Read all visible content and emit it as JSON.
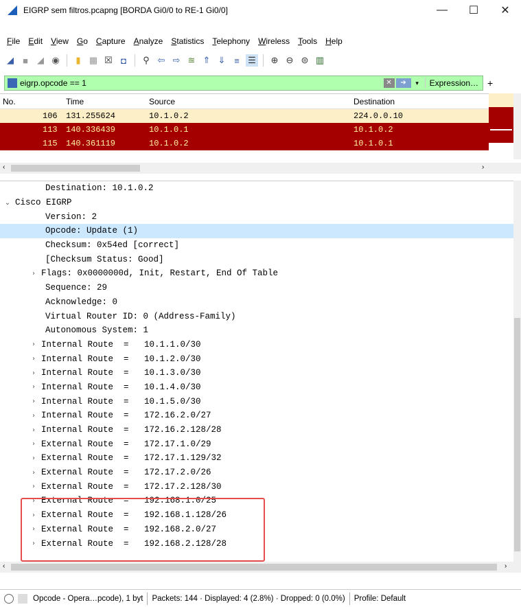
{
  "window": {
    "title": "EIGRP sem filtros.pcapng [BORDA Gi0/0 to RE-1 Gi0/0]",
    "minimize": "—",
    "maximize": "☐",
    "close": "✕"
  },
  "menu": [
    "File",
    "Edit",
    "View",
    "Go",
    "Capture",
    "Analyze",
    "Statistics",
    "Telephony",
    "Wireless",
    "Tools",
    "Help"
  ],
  "filter": {
    "value": "eigrp.opcode == 1",
    "expression_label": "Expression…",
    "plus": "+"
  },
  "packet_list": {
    "columns": [
      "No.",
      "Time",
      "Source",
      "Destination"
    ],
    "rows": [
      {
        "no": "106",
        "time": "131.255624",
        "source": "10.1.0.2",
        "destination": "224.0.0.10",
        "bg": "#fdefc7",
        "fg": "#000000"
      },
      {
        "no": "113",
        "time": "140.336439",
        "source": "10.1.0.1",
        "destination": "10.1.0.2",
        "bg": "#a50000",
        "fg": "#fff4a0"
      },
      {
        "no": "115",
        "time": "140.361119",
        "source": "10.1.0.2",
        "destination": "10.1.0.1",
        "bg": "#a50000",
        "fg": "#fff4a0"
      }
    ]
  },
  "details": [
    {
      "indent": 2,
      "caret": "",
      "text": "Destination: 10.1.0.2"
    },
    {
      "indent": 0,
      "caret": "v",
      "text": "Cisco EIGRP"
    },
    {
      "indent": 2,
      "caret": "",
      "text": "Version: 2"
    },
    {
      "indent": 2,
      "caret": "",
      "text": "Opcode: Update (1)",
      "selected": true
    },
    {
      "indent": 2,
      "caret": "",
      "text": "Checksum: 0x54ed [correct]"
    },
    {
      "indent": 2,
      "caret": "",
      "text": "[Checksum Status: Good]"
    },
    {
      "indent": 1,
      "caret": ">",
      "text": "Flags: 0x0000000d, Init, Restart, End Of Table"
    },
    {
      "indent": 2,
      "caret": "",
      "text": "Sequence: 29"
    },
    {
      "indent": 2,
      "caret": "",
      "text": "Acknowledge: 0"
    },
    {
      "indent": 2,
      "caret": "",
      "text": "Virtual Router ID: 0 (Address-Family)"
    },
    {
      "indent": 2,
      "caret": "",
      "text": "Autonomous System: 1"
    },
    {
      "indent": 1,
      "caret": ">",
      "text": "Internal Route  =   10.1.1.0/30"
    },
    {
      "indent": 1,
      "caret": ">",
      "text": "Internal Route  =   10.1.2.0/30"
    },
    {
      "indent": 1,
      "caret": ">",
      "text": "Internal Route  =   10.1.3.0/30"
    },
    {
      "indent": 1,
      "caret": ">",
      "text": "Internal Route  =   10.1.4.0/30"
    },
    {
      "indent": 1,
      "caret": ">",
      "text": "Internal Route  =   10.1.5.0/30"
    },
    {
      "indent": 1,
      "caret": ">",
      "text": "Internal Route  =   172.16.2.0/27"
    },
    {
      "indent": 1,
      "caret": ">",
      "text": "Internal Route  =   172.16.2.128/28"
    },
    {
      "indent": 1,
      "caret": ">",
      "text": "External Route  =   172.17.1.0/29"
    },
    {
      "indent": 1,
      "caret": ">",
      "text": "External Route  =   172.17.1.129/32"
    },
    {
      "indent": 1,
      "caret": ">",
      "text": "External Route  =   172.17.2.0/26"
    },
    {
      "indent": 1,
      "caret": ">",
      "text": "External Route  =   172.17.2.128/30"
    },
    {
      "indent": 1,
      "caret": ">",
      "text": "External Route  =   192.168.1.0/25"
    },
    {
      "indent": 1,
      "caret": ">",
      "text": "External Route  =   192.168.1.128/26"
    },
    {
      "indent": 1,
      "caret": ">",
      "text": "External Route  =   192.168.2.0/27"
    },
    {
      "indent": 1,
      "caret": ">",
      "text": "External Route  =   192.168.2.128/28"
    }
  ],
  "status": {
    "field": "Opcode - Opera…pcode), 1 byt",
    "packets": "Packets: 144 · Displayed: 4 (2.8%) · Dropped: 0 (0.0%)",
    "profile": "Profile: Default"
  },
  "colors": {
    "selected_detail": "#cce8ff",
    "highlight_box": "#e74c4c",
    "filter_ok": "#afffaf"
  }
}
